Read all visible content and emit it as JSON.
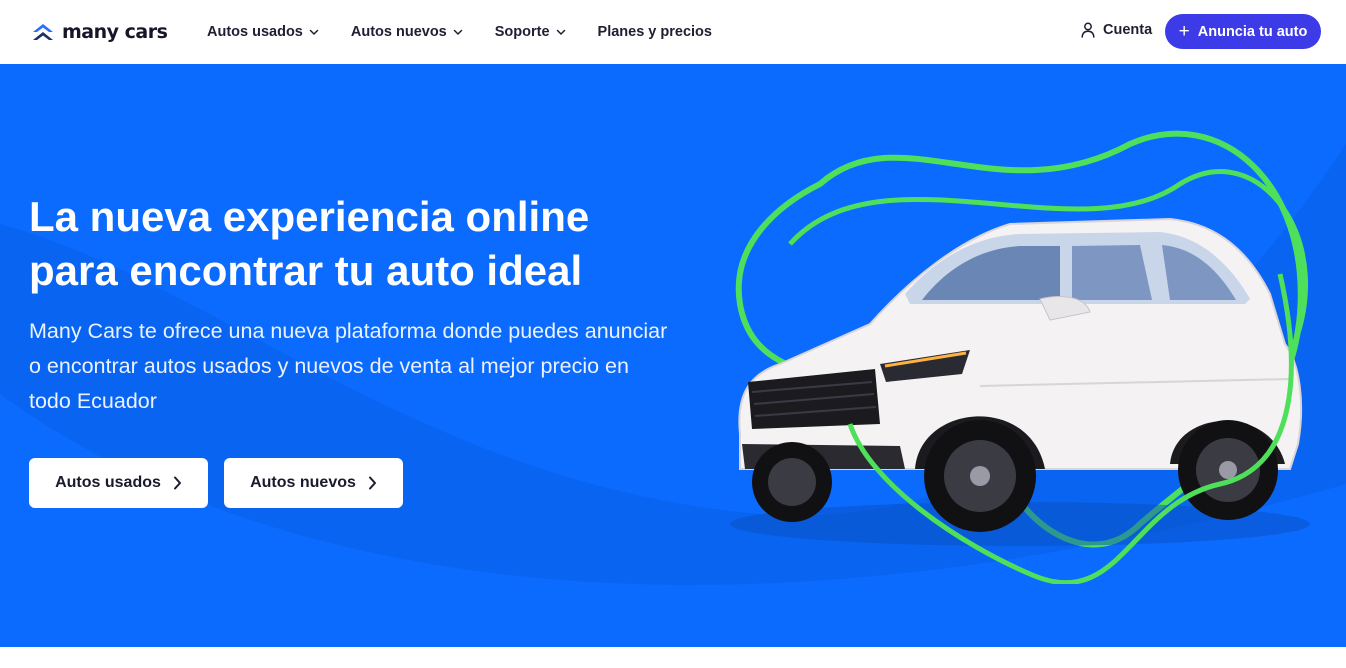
{
  "brand": {
    "name": "many cars",
    "logo_icon": "double-chevron-up-icon",
    "color": "#1a6bff"
  },
  "nav": {
    "items": [
      {
        "label": "Autos usados",
        "has_dropdown": true
      },
      {
        "label": "Autos nuevos",
        "has_dropdown": true
      },
      {
        "label": "Soporte",
        "has_dropdown": true
      },
      {
        "label": "Planes y precios",
        "has_dropdown": false
      }
    ]
  },
  "account": {
    "label": "Cuenta",
    "icon": "user-icon"
  },
  "cta": {
    "label": "Anuncia tu auto",
    "icon": "plus-icon",
    "color": "#3d3be8"
  },
  "hero": {
    "title_line1": "La nueva experiencia online",
    "title_line2": "para encontrar tu auto ideal",
    "subtitle": "Many Cars te ofrece una nueva plataforma donde puedes anunciar o encontrar autos usados y nuevos de venta al mejor precio en todo Ecuador",
    "buttons": [
      {
        "label": "Autos usados",
        "icon": "chevron-right-icon"
      },
      {
        "label": "Autos nuevos",
        "icon": "chevron-right-icon"
      }
    ],
    "background_color": "#0b6bff",
    "accent_ring_color": "#4ee05a",
    "image": "white-suv-car-image"
  }
}
